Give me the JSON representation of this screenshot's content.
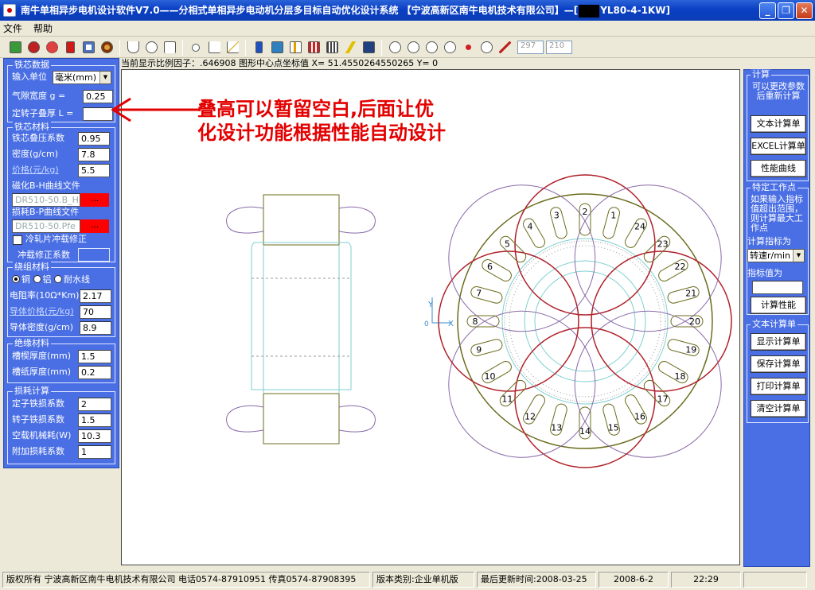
{
  "window": {
    "title": "南牛单相异步电机设计软件V7.0——分相式单相异步电动机分层多目标自动优化设计系统  【宁波高新区南牛电机技术有限公司】—[",
    "title_suffix": "YL80-4-1KW]"
  },
  "menu": {
    "file": "文件",
    "help": "帮助"
  },
  "toolbar": {
    "input_a": "297",
    "input_b": "210"
  },
  "status_line": "当前显示比例因子：.646908  图形中心点坐标值 X= 51.4550264550265 Y= 0",
  "core": {
    "title": "铁芯数据",
    "unit_label": "输入单位",
    "unit_value": "毫米(mm)",
    "gap_label": "气隙宽度    g =",
    "gap_value": "0.25",
    "stack_label": "定转子叠厚  L =",
    "stack_value": ""
  },
  "core_material": {
    "title": "铁芯材料",
    "factor_label": "铁芯叠压系数",
    "factor_value": "0.95",
    "density_label": "密度(g/cm)",
    "density_value": "7.8",
    "price_label": "价格(元/kg)",
    "price_value": "5.5",
    "bh_label": "磁化B-H曲线文件",
    "bh_file": "DR510-50.B_H",
    "bh_btn": "...",
    "loss_label": "损耗B-P曲线文件",
    "loss_file": "DR510-50.Pfe",
    "loss_btn": "...",
    "cold_label": "冷轧片冲载修正",
    "punch_label": "冲载修正系数",
    "punch_value": ""
  },
  "winding": {
    "title": "绕组材料",
    "copper": "铜",
    "aluminum": "铝",
    "waterproof": "耐水线",
    "resist_label": "电阻率(10Ω*Km)",
    "resist_value": "2.17",
    "price_label": "导体价格(元/kg)",
    "price_value": "70",
    "density_label": "导体密度(g/cm)",
    "density_value": "8.9"
  },
  "insulation": {
    "title": "绝缘材料",
    "slot_wedge_label": "槽楔厚度(mm)",
    "slot_wedge_value": "1.5",
    "slot_paper_label": "槽纸厚度(mm)",
    "slot_paper_value": "0.2"
  },
  "loss": {
    "title": "损耗计算",
    "stator_label": "定子铁损系数",
    "stator_value": "2",
    "rotor_label": "转子铁损系数",
    "rotor_value": "1.5",
    "mech_label": "空载机械耗(W)",
    "mech_value": "10.3",
    "extra_label": "附加损耗系数",
    "extra_value": "1"
  },
  "annotation": {
    "line1": "叠高可以暂留空白,后面让优",
    "line2": "化设计功能根据性能自动设计"
  },
  "drawing": {
    "axis_y": "Y",
    "axis_x": "X",
    "axis_zero": "0",
    "slots": [
      "1",
      "2",
      "3",
      "4",
      "5",
      "6",
      "7",
      "8",
      "9",
      "10",
      "11",
      "12",
      "13",
      "14",
      "15",
      "16",
      "17",
      "18",
      "19",
      "20",
      "21",
      "22",
      "23",
      "24"
    ]
  },
  "right": {
    "calc_title": "计算",
    "calc_note": "可以更改参数后重新计算",
    "text_calc": "文本计算单",
    "excel_calc": "EXCEL计算单",
    "curve": "性能曲线",
    "spec_title": "特定工作点",
    "spec_note": "如果输入指标值超出范围，则计算最大工作点",
    "index_label": "计算指标为",
    "index_value": "转速r/min",
    "value_label": "指标值为",
    "value_value": "",
    "calc_perf": "计算性能",
    "text_title": "文本计算单",
    "show": "显示计算单",
    "save": "保存计算单",
    "print": "打印计算单",
    "clear": "清空计算单"
  },
  "statusbar": {
    "copyright": "版权所有  宁波高新区南牛电机技术有限公司  电话0574-87910951  传真0574-87908395",
    "edition": "版本类别:企业单机版",
    "updated": "最后更新时间:2008-03-25",
    "date": "2008-6-2",
    "time": "22:29"
  },
  "colors": {
    "panel": "#4a6fe4",
    "titlebar": "#0a3fc4",
    "annotation": "#e30000",
    "stator": "#6b6b1e",
    "coil": "#b0202a",
    "rotor": "#7fcfcf",
    "dash": "#9a9a9a"
  }
}
